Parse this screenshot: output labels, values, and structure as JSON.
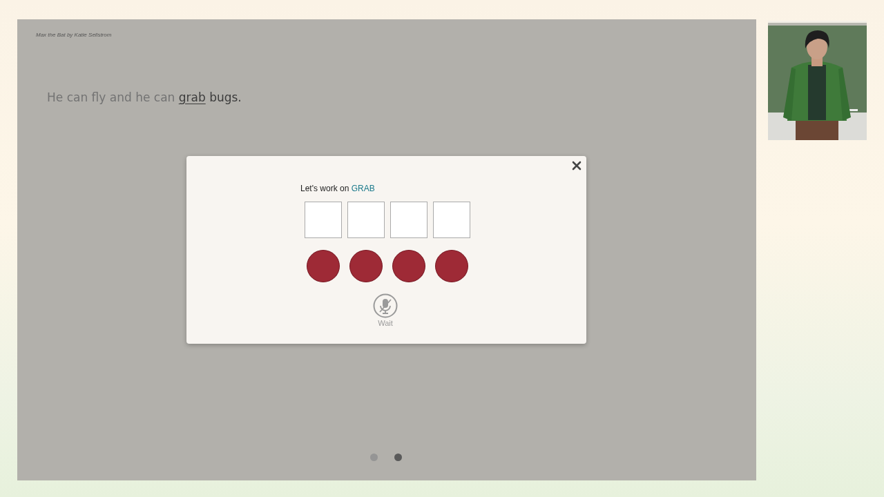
{
  "book": {
    "credit": "Max the Bat by Katie Sellstrom"
  },
  "sentence": [
    {
      "text": "He can fly and he can",
      "kind": "read"
    },
    {
      "text": "grab",
      "kind": "current"
    },
    {
      "text": "bugs.",
      "kind": "unread"
    }
  ],
  "dialog": {
    "prompt": "Let's work on",
    "word": "GRAB",
    "letter_boxes": [
      {
        "kind": "empty"
      },
      {
        "kind": "empty"
      },
      {
        "kind": "empty"
      },
      {
        "kind": "empty"
      }
    ],
    "sound_dots": [
      {
        "kind": "sound"
      },
      {
        "kind": "sound"
      },
      {
        "kind": "sound"
      },
      {
        "kind": "sound"
      }
    ],
    "mic": {
      "label": "Wait",
      "disabled": true
    }
  },
  "pages": [
    {
      "selected": false
    },
    {
      "selected": true
    }
  ]
}
